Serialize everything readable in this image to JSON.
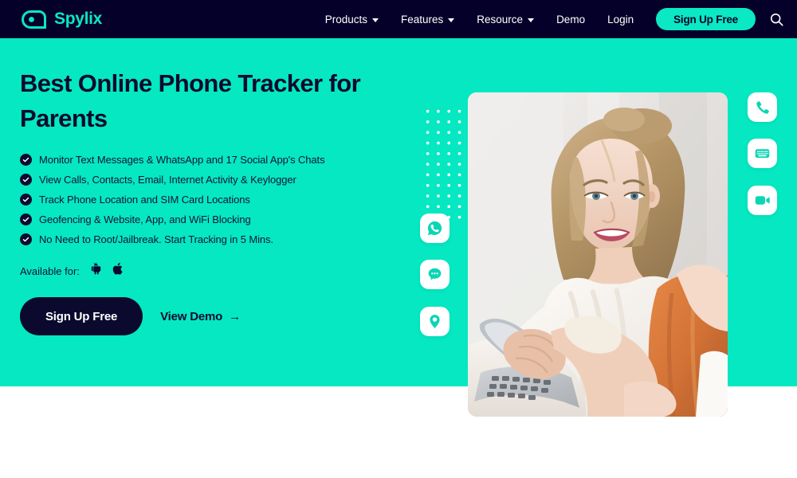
{
  "brand": {
    "name": "Spylix",
    "logo_icon": "spylix-bubble-logo",
    "logo_color": "#0ae8c4"
  },
  "nav": {
    "items": [
      {
        "label": "Products",
        "has_dropdown": true
      },
      {
        "label": "Features",
        "has_dropdown": true
      },
      {
        "label": "Resource",
        "has_dropdown": true
      },
      {
        "label": "Demo",
        "has_dropdown": false
      },
      {
        "label": "Login",
        "has_dropdown": false
      }
    ],
    "cta_label": "Sign Up Free",
    "search_icon": "search-icon",
    "background_color": "#050029",
    "cta_color": "#0ae8c4"
  },
  "hero": {
    "background_color": "#05e8c2",
    "headline": "Best Online Phone Tracker for Parents",
    "bullets": [
      "Monitor Text Messages & WhatsApp and 17 Social App's Chats",
      "View Calls, Contacts, Email, Internet Activity & Keylogger",
      "Track Phone Location and SIM Card Locations",
      "Geofencing & Website, App, and WiFi Blocking",
      "No Need to Root/Jailbreak. Start Tracking in 5 Mins."
    ],
    "availability": {
      "label": "Available for:",
      "platforms": [
        "android-icon",
        "apple-icon"
      ]
    },
    "primary_cta": "Sign Up Free",
    "secondary_cta": "View Demo",
    "secondary_cta_arrow": "→",
    "photo_alt": "mother-and-daughter-using-phone-photo"
  },
  "floating_icons": {
    "left": [
      {
        "name": "whatsapp-icon"
      },
      {
        "name": "chat-bubble-icon"
      },
      {
        "name": "location-pin-icon"
      }
    ],
    "right": [
      {
        "name": "phone-call-icon"
      },
      {
        "name": "keyboard-keylogger-icon"
      },
      {
        "name": "video-camera-icon"
      }
    ],
    "glyph_color": "#0ad6b4"
  }
}
